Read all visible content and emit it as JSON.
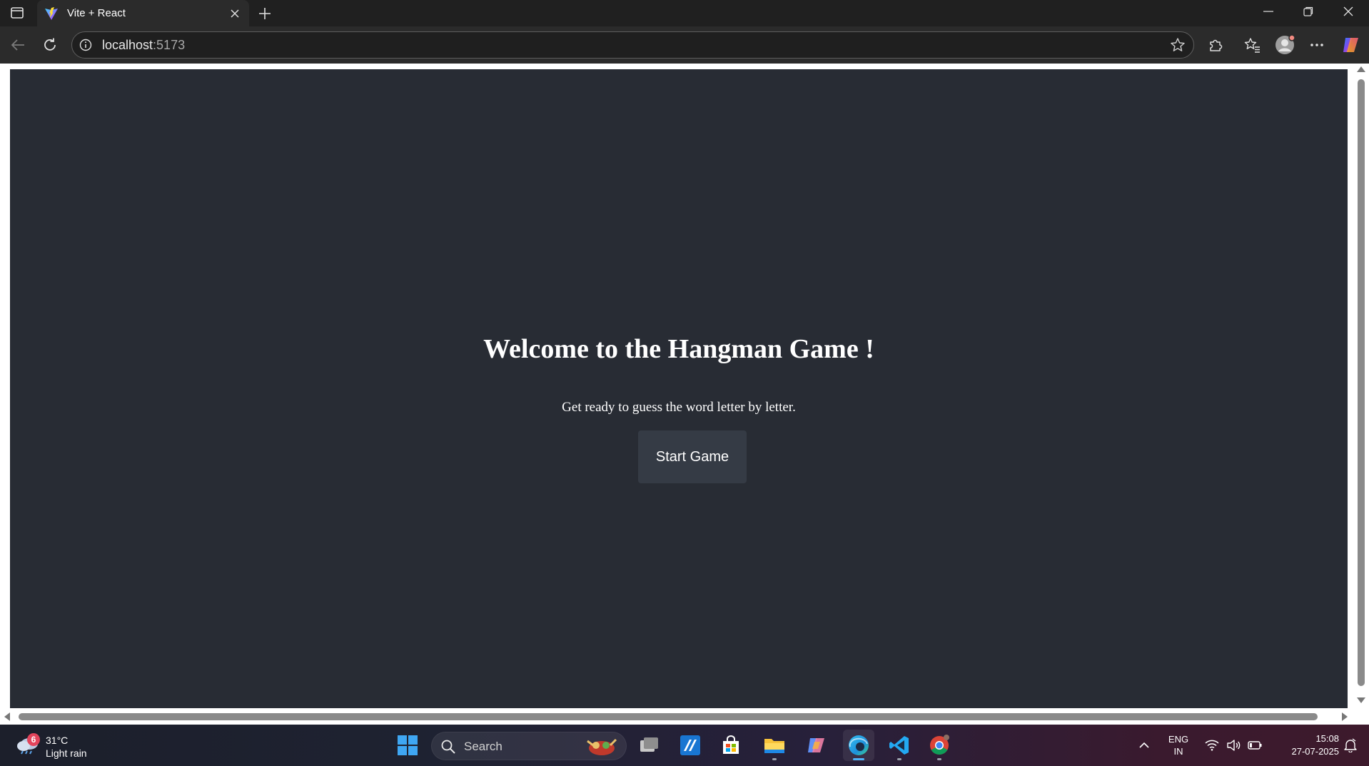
{
  "browser": {
    "tab": {
      "title": "Vite + React"
    },
    "url": {
      "host": "localhost",
      "port": ":5173"
    }
  },
  "page": {
    "heading": "Welcome to the Hangman Game !",
    "subtitle": "Get ready to guess the word letter by letter.",
    "start_button": "Start Game",
    "background": "#282c34",
    "button_bg": "#353b45"
  },
  "taskbar": {
    "weather": {
      "badge": "6",
      "temp": "31°C",
      "condition": "Light rain"
    },
    "search_label": "Search",
    "lang_line1": "ENG",
    "lang_line2": "IN",
    "time": "15:08",
    "date": "27-07-2025"
  }
}
